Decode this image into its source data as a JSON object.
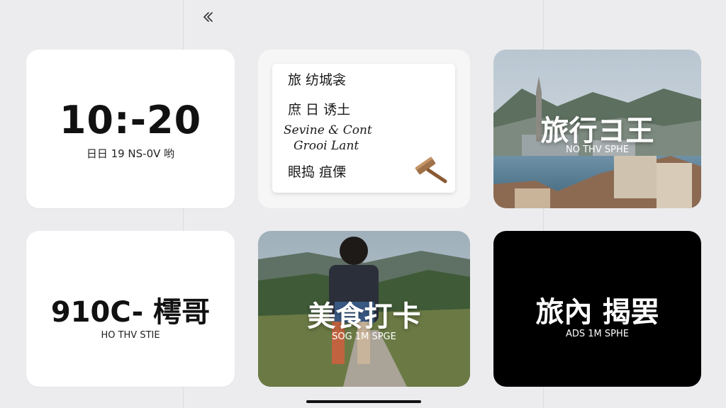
{
  "widgets": [
    {
      "id": "clock",
      "time": "10:-20",
      "subtitle": "日日 19 NS-0V 哟"
    },
    {
      "id": "note",
      "lines": [
        "旅 纺城衾",
        "庶 日 诱土",
        "Sevine & Cont",
        "Grooi Lant",
        "眼捣 疽傈"
      ],
      "icon": "gavel-icon"
    },
    {
      "id": "travel-photo",
      "title": "旅行ヨ王",
      "subtitle": "NO THV SPHE"
    },
    {
      "id": "text-white",
      "title": "910C- 樗哥",
      "subtitle": "HO THV STIE"
    },
    {
      "id": "food-photo",
      "title": "美食打卡",
      "subtitle": "SOG 1M SPGE"
    },
    {
      "id": "black-card",
      "title": "旅內 揭罢",
      "subtitle": "ADS 1M SPHE"
    }
  ],
  "icons": {
    "back": "double-chevron-left-icon"
  },
  "colors": {
    "background": "#ececee",
    "card_white": "#ffffff",
    "card_black": "#000000"
  }
}
